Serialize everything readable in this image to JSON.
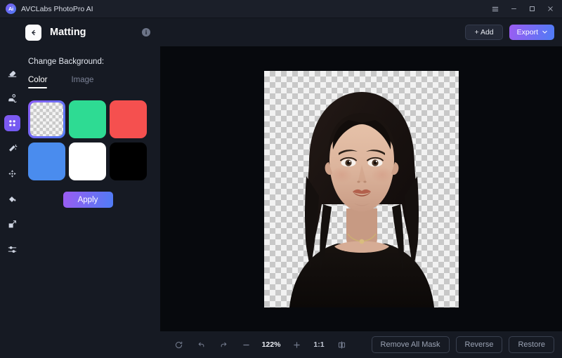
{
  "titlebar": {
    "logo_text": "Ai",
    "app_name": "AVCLabs PhotoPro AI",
    "menu_icon": "hamburger-menu-icon",
    "minimize": "−",
    "maximize": "□",
    "close": "✕"
  },
  "rail": {
    "items": [
      {
        "name": "eraser-tool",
        "icon": "eraser-icon"
      },
      {
        "name": "portrait-retouch-tool",
        "icon": "portrait-gear-icon"
      },
      {
        "name": "matting-tool",
        "icon": "matting-icon",
        "active": true
      },
      {
        "name": "magic-wand-tool",
        "icon": "magic-wand-icon"
      },
      {
        "name": "enhance-tool",
        "icon": "expand-arrows-icon"
      },
      {
        "name": "colorize-tool",
        "icon": "paint-bucket-icon"
      },
      {
        "name": "resize-tool",
        "icon": "resize-icon"
      },
      {
        "name": "adjust-tool",
        "icon": "sliders-icon"
      }
    ]
  },
  "panel": {
    "back_icon": "arrow-left-icon",
    "title": "Matting",
    "info_icon": "i",
    "section_label": "Change Background:",
    "tabs": [
      {
        "label": "Color",
        "active": true
      },
      {
        "label": "Image",
        "active": false
      }
    ],
    "swatches": [
      {
        "name": "transparent",
        "color": "transparent",
        "selected": true
      },
      {
        "name": "green",
        "color": "#2edb93",
        "selected": false
      },
      {
        "name": "red",
        "color": "#f5504f",
        "selected": false
      },
      {
        "name": "blue",
        "color": "#4a8cee",
        "selected": false
      },
      {
        "name": "white",
        "color": "#ffffff",
        "selected": false
      },
      {
        "name": "black",
        "color": "#000000",
        "selected": false
      }
    ],
    "apply_label": "Apply"
  },
  "workspace": {
    "add_label": "+ Add",
    "export_label": "Export",
    "export_caret": "⌄",
    "zoom": {
      "reset_icon": "refresh-icon",
      "undo_icon": "undo-icon",
      "redo_icon": "redo-icon",
      "zoom_out": "−",
      "percent": "122%",
      "zoom_in": "+",
      "ratio": "1:1",
      "compare_icon": "split-compare-icon"
    },
    "actions": [
      {
        "name": "remove-all-mask-button",
        "label": "Remove All Mask"
      },
      {
        "name": "reverse-button",
        "label": "Reverse"
      },
      {
        "name": "restore-button",
        "label": "Restore"
      }
    ],
    "image_alt": "portrait-photo-transparent-background"
  },
  "colors": {
    "accent_purple": "#9b5cf2",
    "accent_blue": "#4f7cf5",
    "canvas_bg": "#07090d",
    "panel_bg": "#161a23",
    "titlebar_bg": "#1b1f29"
  }
}
